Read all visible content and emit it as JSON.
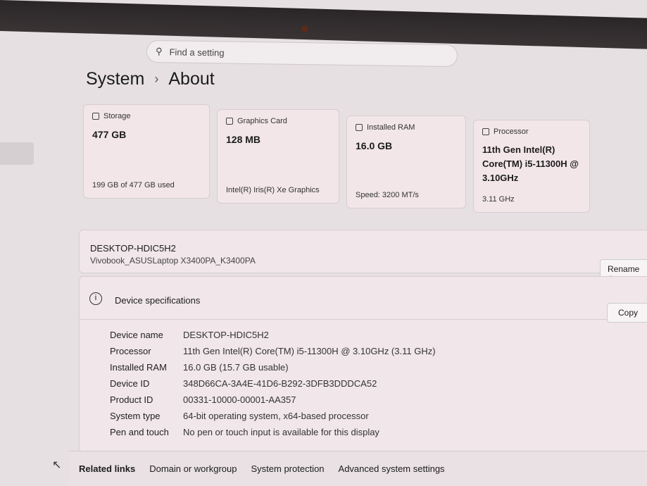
{
  "search": {
    "placeholder": "Find a setting"
  },
  "breadcrumb": {
    "parent": "System",
    "sep": "›",
    "current": "About"
  },
  "cards": [
    {
      "label": "Storage",
      "value": "477 GB",
      "footer": "199 GB of 477 GB used",
      "icon": "storage-icon"
    },
    {
      "label": "Graphics Card",
      "value": "128 MB",
      "footer": "Intel(R) Iris(R) Xe Graphics",
      "icon": "graphics-card-icon"
    },
    {
      "label": "Installed RAM",
      "value": "16.0 GB",
      "footer": "Speed: 3200 MT/s",
      "icon": "ram-icon"
    },
    {
      "label": "Processor",
      "value": "11th Gen Intel(R) Core(TM) i5-11300H @ 3.10GHz",
      "footer": "3.11 GHz",
      "icon": "processor-icon"
    }
  ],
  "device": {
    "name": "DESKTOP-HDIC5H2",
    "model": "Vivobook_ASUSLaptop X3400PA_K3400PA",
    "rename": "Rename th"
  },
  "specs": {
    "title": "Device specifications",
    "copy": "Copy",
    "rows": [
      {
        "k": "Device name",
        "v": "DESKTOP-HDIC5H2"
      },
      {
        "k": "Processor",
        "v": "11th Gen Intel(R) Core(TM) i5-11300H @ 3.10GHz (3.11 GHz)"
      },
      {
        "k": "Installed RAM",
        "v": "16.0 GB (15.7 GB usable)"
      },
      {
        "k": "Device ID",
        "v": "348D66CA-3A4E-41D6-B292-3DFB3DDDCA52"
      },
      {
        "k": "Product ID",
        "v": "00331-10000-00001-AA357"
      },
      {
        "k": "System type",
        "v": "64-bit operating system, x64-based processor"
      },
      {
        "k": "Pen and touch",
        "v": "No pen or touch input is available for this display"
      }
    ]
  },
  "related": {
    "title": "Related links",
    "links": [
      "Domain or workgroup",
      "System protection",
      "Advanced system settings"
    ]
  }
}
